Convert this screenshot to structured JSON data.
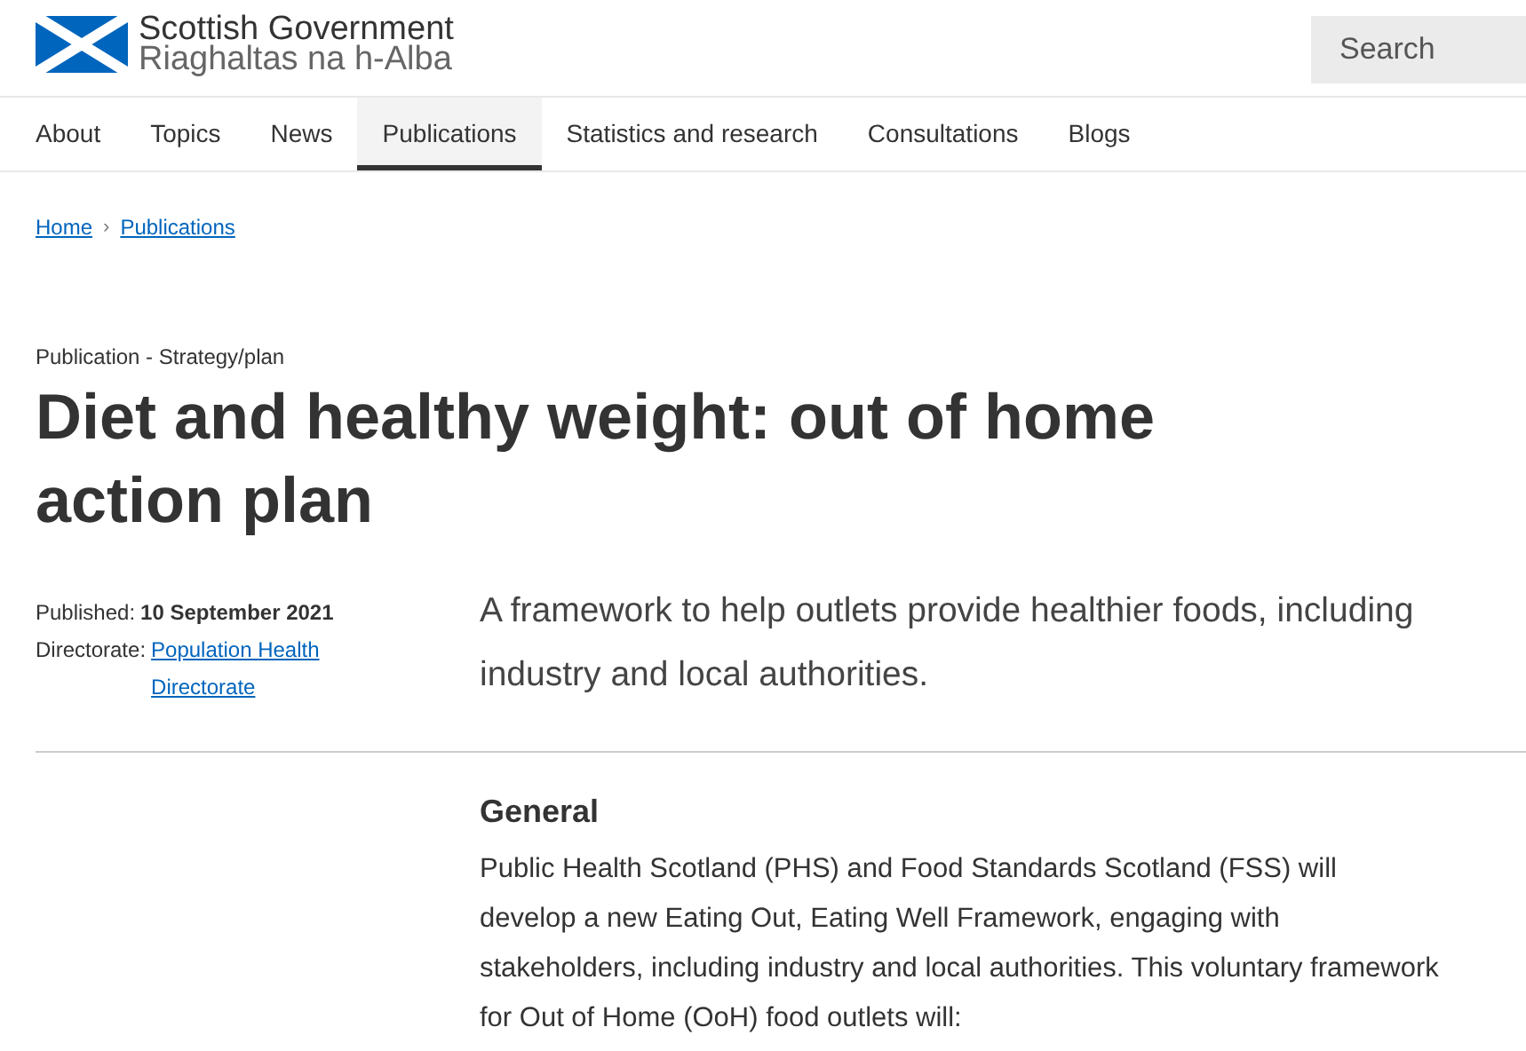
{
  "header": {
    "logo_name": "Scottish Government",
    "logo_subname": "Riaghaltas na h-Alba",
    "search": {
      "placeholder": "Search"
    }
  },
  "nav": [
    {
      "label": "About",
      "selected": false
    },
    {
      "label": "Topics",
      "selected": false
    },
    {
      "label": "News",
      "selected": false
    },
    {
      "label": "Publications",
      "selected": true
    },
    {
      "label": "Statistics and research",
      "selected": false
    },
    {
      "label": "Consultations",
      "selected": false
    },
    {
      "label": "Blogs",
      "selected": false
    }
  ],
  "breadcrumb": [
    {
      "label": "Home"
    },
    {
      "label": "Publications"
    }
  ],
  "breadcrumb_separator": "›",
  "page_type": "Publication - Strategy/plan",
  "title": "Diet and healthy weight: out of home action plan",
  "meta": {
    "published_label": "Published:",
    "published": "10 September 2021",
    "directorate_label": "Directorate:",
    "directorate": "Population Health Directorate"
  },
  "summary": "A framework to help outlets provide healthier foods, including industry and local authorities.",
  "section": {
    "heading": "General",
    "body": "Public Health Scotland (PHS) and Food Standards Scotland (FSS) will develop a new Eating Out, Eating Well Framework, engaging with stakeholders, including industry and local authorities. This voluntary framework for Out of Home (OoH) food outlets will:"
  }
}
